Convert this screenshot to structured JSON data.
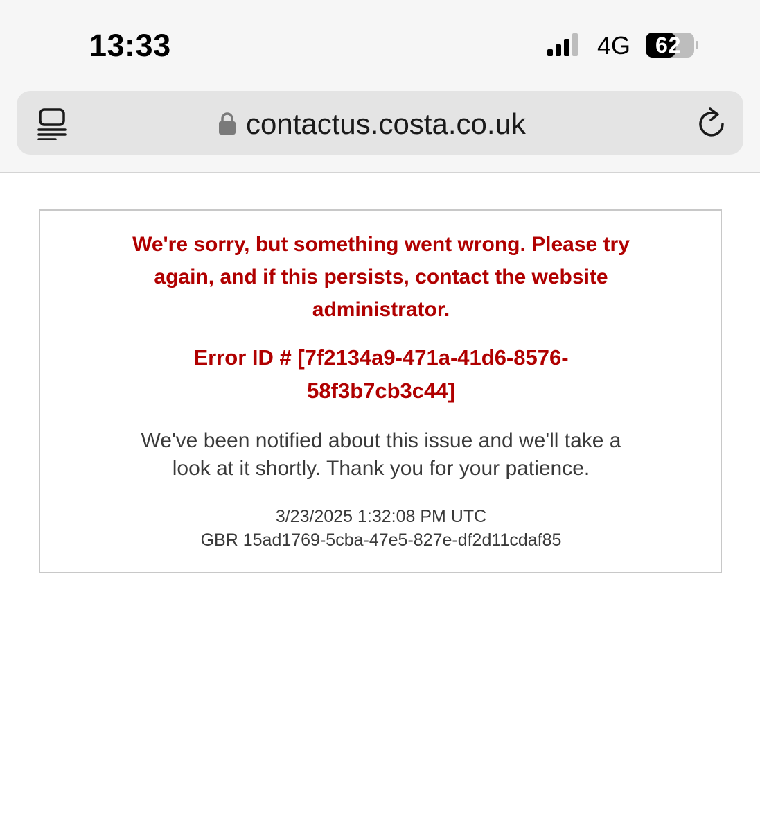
{
  "status_bar": {
    "time": "13:33",
    "network": "4G",
    "battery_level": "62",
    "battery_percent": 62,
    "signal_bars_active": 3,
    "signal_bars_total": 4
  },
  "browser": {
    "url": "contactus.costa.co.uk",
    "icons": {
      "tabs": "tabs-icon",
      "lock": "lock-icon",
      "reload": "reload-icon"
    }
  },
  "error": {
    "heading": "We're sorry, but something went wrong. Please try again, and if this persists, contact the website administrator.",
    "error_id": "Error ID # [7f2134a9-471a-41d6-8576-58f3b7cb3c44]",
    "notice": "We've been notified about this issue and we'll take a look at it shortly. Thank you for your patience.",
    "timestamp": "3/23/2025 1:32:08 PM UTC",
    "trace": "GBR 15ad1769-5cba-47e5-827e-df2d11cdaf85"
  },
  "colors": {
    "error_red": "#b00000",
    "body_text": "#3a3a3a",
    "chrome_background": "#f6f6f6",
    "address_bar": "#e4e4e4"
  }
}
